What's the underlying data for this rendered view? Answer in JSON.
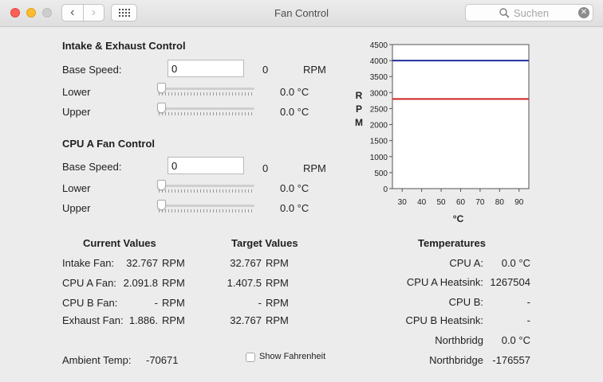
{
  "window": {
    "title": "Fan Control",
    "search_placeholder": "Suchen",
    "nav_back": "‹",
    "nav_forward": "›"
  },
  "intake_exhaust": {
    "heading": "Intake & Exhaust Control",
    "base_speed_label": "Base Speed:",
    "base_speed_value": "0",
    "base_speed_readout": "0",
    "unit_rpm": "RPM",
    "lower_label": "Lower",
    "lower_value": "0.0 °C",
    "upper_label": "Upper",
    "upper_value": "0.0 °C"
  },
  "cpu_a": {
    "heading": "CPU A Fan Control",
    "base_speed_label": "Base Speed:",
    "base_speed_value": "0",
    "base_speed_readout": "0",
    "unit_rpm": "RPM",
    "lower_label": "Lower",
    "lower_value": "0.0 °C",
    "upper_label": "Upper",
    "upper_value": "0.0 °C"
  },
  "current_values": {
    "heading": "Current Values",
    "rows": [
      {
        "label": "Intake Fan:",
        "value": "32.767",
        "unit": "RPM"
      },
      {
        "label": "CPU A Fan:",
        "value": "2.091.8",
        "unit": "RPM"
      },
      {
        "label": "CPU B Fan:",
        "value": "-",
        "unit": "RPM"
      },
      {
        "label": "Exhaust Fan:",
        "value": "1.886.",
        "unit": "RPM"
      }
    ]
  },
  "target_values": {
    "heading": "Target Values",
    "rows": [
      {
        "value": "32.767",
        "unit": "RPM"
      },
      {
        "value": "1.407.5",
        "unit": "RPM"
      },
      {
        "value": "-",
        "unit": "RPM"
      },
      {
        "value": "32.767",
        "unit": "RPM"
      }
    ]
  },
  "temperatures": {
    "heading": "Temperatures",
    "rows": [
      {
        "label": "CPU A:",
        "value": "0.0 °C"
      },
      {
        "label": "CPU A Heatsink:",
        "value": "1267504"
      },
      {
        "label": "CPU B:",
        "value": "-"
      },
      {
        "label": "CPU B Heatsink:",
        "value": "-"
      },
      {
        "label": "Northbridg",
        "value": "0.0 °C"
      },
      {
        "label": "Northbridge",
        "value": "-176557"
      }
    ]
  },
  "ambient": {
    "label": "Ambient Temp:",
    "value": "-70671"
  },
  "show_fahrenheit": {
    "label": "Show Fahrenheit",
    "checked": false
  },
  "chart_data": {
    "type": "line",
    "xlabel": "°C",
    "ylabel": "RPM",
    "xlim": [
      25,
      95
    ],
    "ylim": [
      0,
      4500
    ],
    "x_ticks": [
      30,
      40,
      50,
      60,
      70,
      80,
      90
    ],
    "y_ticks": [
      0,
      500,
      1000,
      1500,
      2000,
      2500,
      3000,
      3500,
      4000,
      4500
    ],
    "grid": false,
    "series": [
      {
        "color": "#1f2f9a",
        "x": [
          25,
          95
        ],
        "y": [
          4000,
          4000
        ]
      },
      {
        "color": "#cc2222",
        "x": [
          25,
          95
        ],
        "y": [
          2800,
          2800
        ]
      }
    ]
  }
}
